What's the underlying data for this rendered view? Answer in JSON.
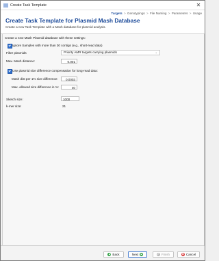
{
  "window": {
    "title": "Create Task Template"
  },
  "steps": [
    "Targets",
    "Genotypings",
    "File Naming",
    "Parameters",
    "Usage"
  ],
  "steps_sep": ">",
  "header": {
    "title": "Create Task Template for Plasmid Mash Database",
    "subtitle": "Create a new Task Template with a Mash database for plasmid analysis."
  },
  "form": {
    "intro": "Create a new Mash Plasmid database with these settings:",
    "ignore_samples_label": "Ignore Samples with more than 30 contigs (e.g., short-read data)",
    "ignore_samples_checked": true,
    "filter_plasmids_label": "Filter plasmids",
    "filter_plasmids_value": "Priority AMR targets carrying plasmids",
    "max_mash_distance_label": "Max. Mash distance:",
    "max_mash_distance_value": "0.001",
    "size_compensation_label": "Use plasmid size difference compensation for long-read data:",
    "size_compensation_checked": true,
    "mash_dist_label": "Mash dist per 1% size difference:",
    "mash_dist_value": "0.0003",
    "max_size_diff_label": "Max. allowed size difference in %:",
    "max_size_diff_value": "40",
    "sketch_size_label": "Sketch size:",
    "sketch_size_value": "1000",
    "kmer_size_label": "k-mer size:",
    "kmer_size_value": "21"
  },
  "buttons": {
    "back": "Back",
    "next": "Next",
    "finish": "Finish",
    "cancel": "Cancel"
  }
}
